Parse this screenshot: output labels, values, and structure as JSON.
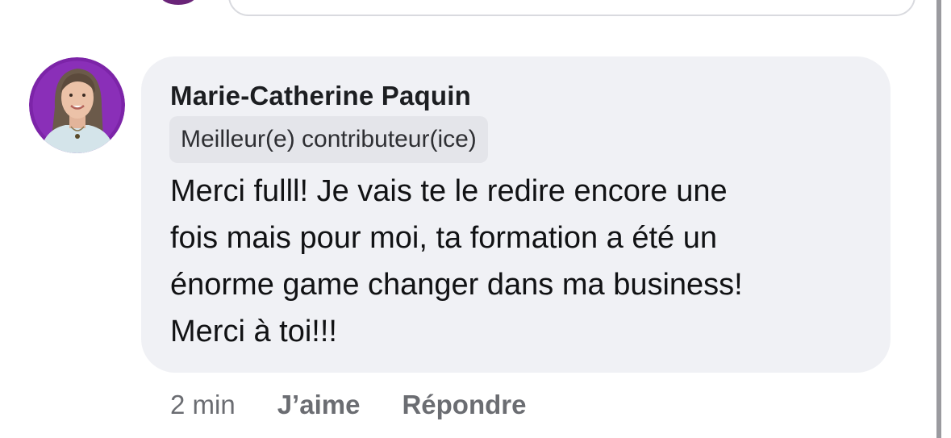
{
  "comment": {
    "author": "Marie-Catherine Paquin",
    "badge": "Meilleur(e) contributeur(ice)",
    "text_lines": [
      "Merci fulll! Je vais te le redire encore une",
      "fois mais pour moi, ta formation a été un",
      "énorme game changer dans ma business!",
      "Merci à toi!!!"
    ],
    "time": "2 min",
    "like_label": "J’aime",
    "reply_label": "Répondre"
  },
  "colors": {
    "bubble": "#f0f1f5",
    "badge": "#e4e5ea",
    "avatar_ring": "#7c24a8",
    "meta_text": "#6b6d72"
  },
  "icons": {
    "avatar": "profile-photo"
  }
}
